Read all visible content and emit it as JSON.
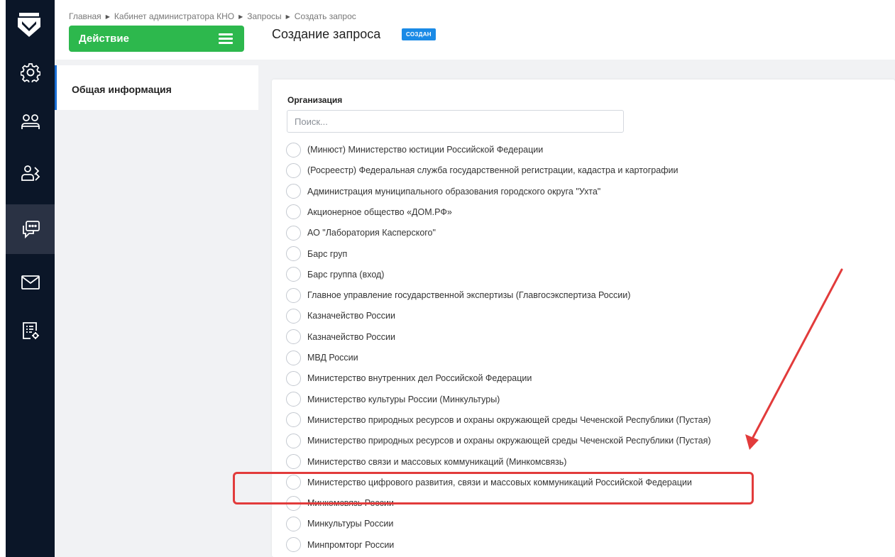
{
  "breadcrumbs": [
    "Главная",
    "Кабинет администратора КНО",
    "Запросы",
    "Создать запрос"
  ],
  "action_button": {
    "label": "Действие"
  },
  "page_title": "Создание запроса",
  "status_badge": "СОЗДАН",
  "left_nav": {
    "items": [
      {
        "label": "Общая информация",
        "active": true
      }
    ]
  },
  "form": {
    "organization_label": "Организация",
    "search_placeholder": "Поиск...",
    "options": [
      "(Минюст) Министерство юстиции Российской Федерации",
      "(Росреестр) Федеральная служба государственной регистрации, кадастра и картографии",
      "Администрация муниципального образования городского округа \"Ухта\"",
      "Акционерное общество «ДОМ.РФ»",
      "АО \"Лаборатория Касперского\"",
      "Барс груп",
      "Барс группа (вход)",
      "Главное управление государственной экспертизы (Главгосэкспертиза России)",
      "Казначейство России",
      "Казначейство России",
      "МВД России",
      "Министерство внутренних дел Российской Федерации",
      "Министерство культуры России (Минкультуры)",
      "Министерство природных ресурсов и охраны окружающей среды Чеченской Республики (Пустая)",
      "Министерство природных ресурсов и охраны окружающей среды Чеченской Республики (Пустая)",
      "Министерство связи и массовых коммуникаций (Минкомсвязь)",
      "Министерство цифрового развития, связи и массовых коммуникаций Российской Федерации",
      "Минкомсвязь России",
      "Минкультуры России",
      "Минпромторг России"
    ]
  },
  "sidebar_icons": [
    "settings-icon",
    "users-icon",
    "user-requests-icon",
    "chat-icon",
    "mail-icon",
    "report-settings-icon"
  ],
  "colors": {
    "sidebar": "#0b1628",
    "action": "#2db84d",
    "badge": "#1a8ae6",
    "highlight": "#e23b3b",
    "accent": "#1a6fd6"
  }
}
